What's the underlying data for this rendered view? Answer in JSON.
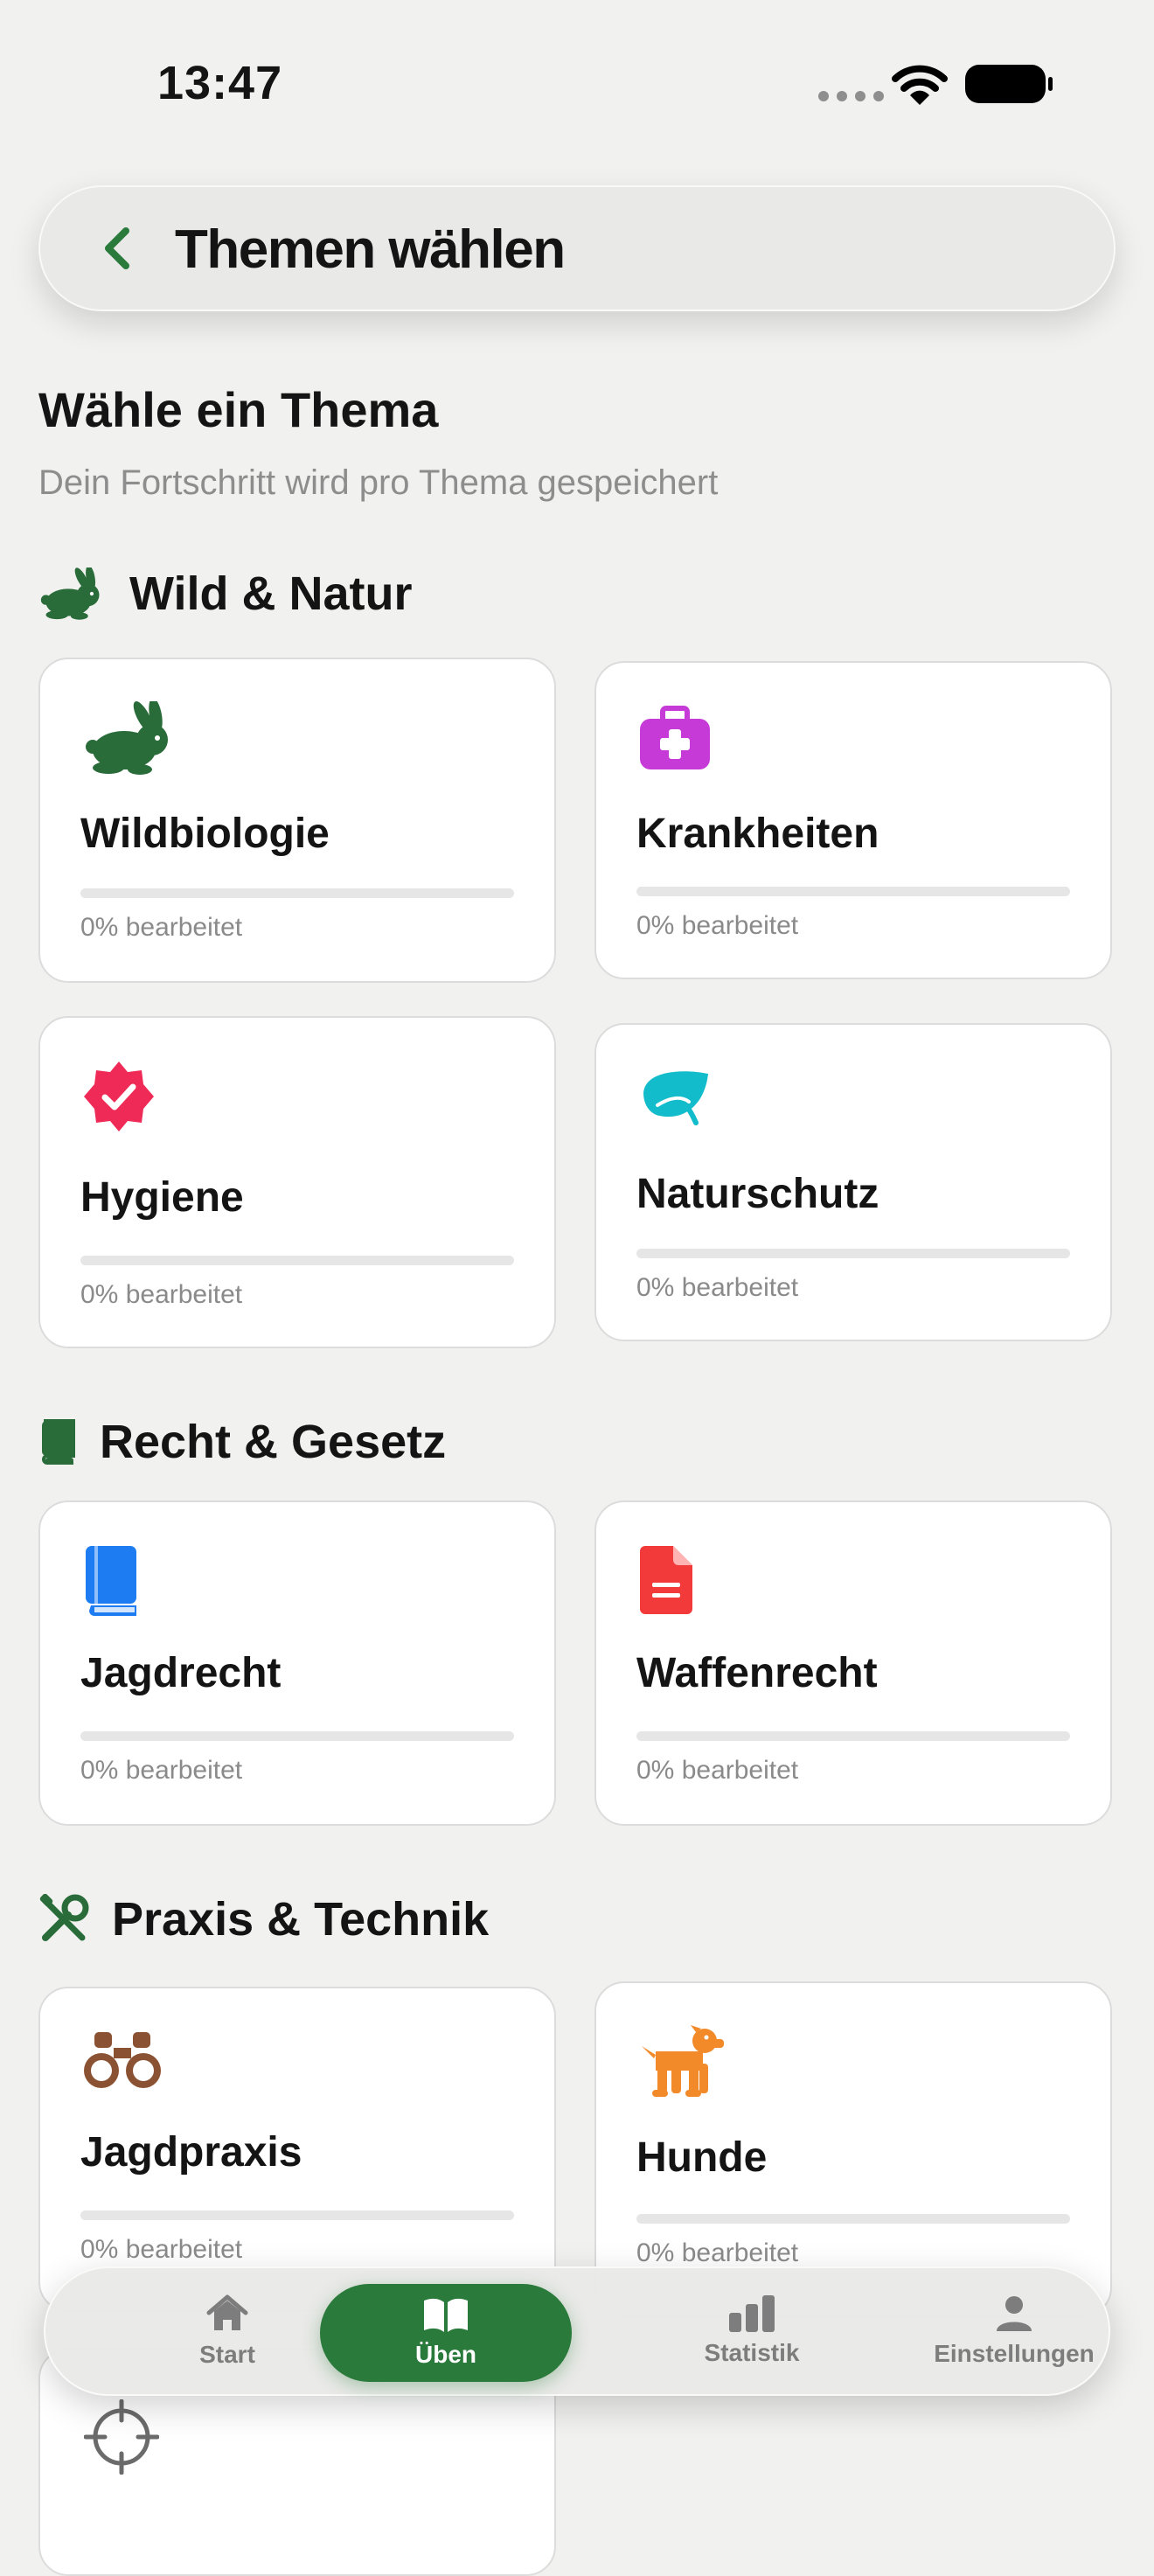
{
  "status": {
    "time": "13:47"
  },
  "nav": {
    "title": "Themen wählen"
  },
  "page": {
    "heading": "Wähle ein Thema",
    "subtitle": "Dein Fortschritt wird pro Thema gespeichert"
  },
  "sections": [
    {
      "title": "Wild & Natur",
      "icon": "rabbit-icon",
      "color": "#2a6b3a",
      "cards": [
        {
          "title": "Wildbiologie",
          "icon": "rabbit-icon",
          "color": "#2a6b3a",
          "progress_value": 0,
          "progress_text": "0% bearbeitet"
        },
        {
          "title": "Krankheiten",
          "icon": "medical-kit-icon",
          "color": "#c63bd8",
          "progress_value": 0,
          "progress_text": "0% bearbeitet"
        },
        {
          "title": "Hygiene",
          "icon": "verified-badge-icon",
          "color": "#ef2a57",
          "progress_value": 0,
          "progress_text": "0% bearbeitet"
        },
        {
          "title": "Naturschutz",
          "icon": "leaf-icon",
          "color": "#13bccb",
          "progress_value": 0,
          "progress_text": "0% bearbeitet"
        }
      ]
    },
    {
      "title": "Recht & Gesetz",
      "icon": "book-icon",
      "color": "#2a6b3a",
      "cards": [
        {
          "title": "Jagdrecht",
          "icon": "book-icon",
          "color": "#1e7cf2",
          "progress_value": 0,
          "progress_text": "0% bearbeitet"
        },
        {
          "title": "Waffenrecht",
          "icon": "document-icon",
          "color": "#f23a3a",
          "progress_value": 0,
          "progress_text": "0% bearbeitet"
        }
      ]
    },
    {
      "title": "Praxis & Technik",
      "icon": "tools-icon",
      "color": "#2a6b3a",
      "cards": [
        {
          "title": "Jagdpraxis",
          "icon": "binoculars-icon",
          "color": "#8a5232",
          "progress_value": 0,
          "progress_text": "0% bearbeitet"
        },
        {
          "title": "Hunde",
          "icon": "dog-icon",
          "color": "#f28a2a",
          "progress_value": 0,
          "progress_text": "0% bearbeitet"
        },
        {
          "icon": "crosshair-icon",
          "color": "#6b6b6b"
        }
      ]
    }
  ],
  "tabbar": {
    "items": [
      {
        "label": "Start",
        "icon": "house-icon",
        "active": false
      },
      {
        "label": "Üben",
        "icon": "open-book-icon",
        "active": true
      },
      {
        "label": "Statistik",
        "icon": "bar-chart-icon",
        "active": false
      },
      {
        "label": "Einstellungen",
        "icon": "person-icon",
        "active": false
      }
    ]
  },
  "colors": {
    "accent": "#2a7a3b",
    "background": "#f1f2ef"
  }
}
